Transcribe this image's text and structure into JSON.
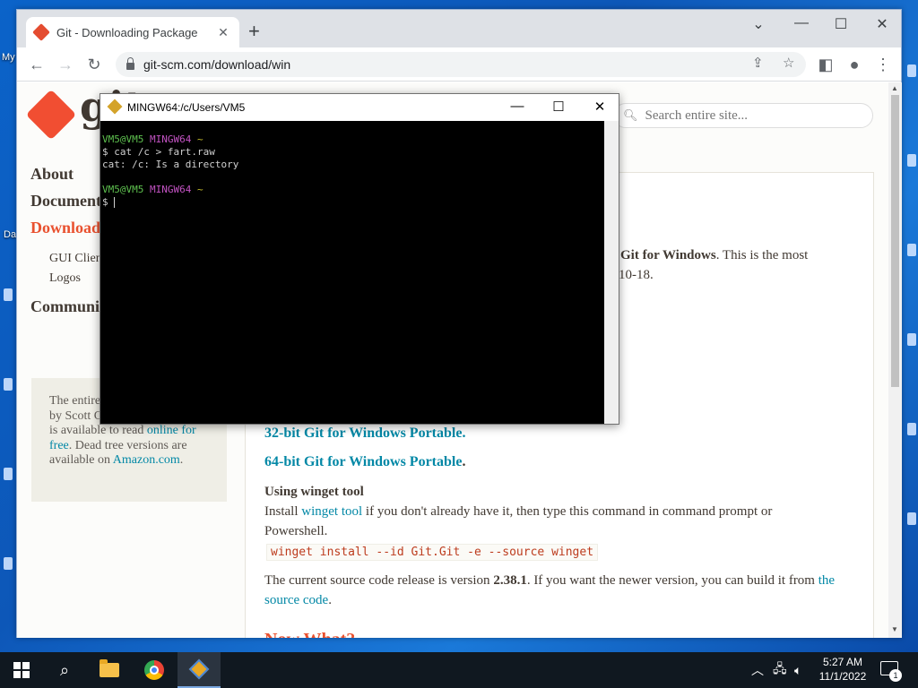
{
  "desktop": {
    "labels": [
      "My",
      "Da"
    ]
  },
  "browser": {
    "tab_title": "Git - Downloading Package",
    "url": "git-scm.com/download/win",
    "icons": {
      "back": "back-arrow-icon",
      "forward": "forward-arrow-icon",
      "reload": "reload-icon",
      "share": "share-icon",
      "bookmark": "star-icon",
      "sidebar": "side-panel-icon",
      "profile": "profile-icon",
      "menu": "kebab-menu-icon"
    }
  },
  "site": {
    "logo_text": "git",
    "search_placeholder": "Search entire site...",
    "nav": [
      {
        "label": "About"
      },
      {
        "label": "Documentation"
      },
      {
        "label": "Downloads"
      },
      {
        "label": "Community"
      }
    ],
    "subnav": [
      "GUI Clients",
      "Logos"
    ],
    "book": {
      "text_before": "The entire Pro Git book written by Scott Chacon and Ben Straub is available to read ",
      "link1": "online for free",
      "text_mid": ". Dead tree versions are available on ",
      "link2": "Amazon.com",
      "text_after": "."
    },
    "main": {
      "intro_bold": "Git for Windows",
      "intro_rest": ". This is the most",
      "intro_line2": "10-18.",
      "portable_32": "32-bit Git for Windows Portable.",
      "portable_64": "64-bit Git for Windows Portable",
      "winget_heading": "Using winget tool",
      "winget_p1_a": "Install ",
      "winget_p1_link": "winget tool",
      "winget_p1_b": " if you don't already have it, then type this command in command prompt or",
      "winget_p1_c": "Powershell.",
      "winget_cmd": "winget install --id Git.Git -e --source winget",
      "source_a": "The current source code release is version ",
      "source_version": "2.38.1",
      "source_b": ". If you want the newer version, you can build it from ",
      "source_link1": "the",
      "source_link2": "source code",
      "source_c": ".",
      "now_what": "Now What?"
    }
  },
  "terminal": {
    "title": "MINGW64:/c/Users/VM5",
    "prompt_user": "VM5@VM5",
    "prompt_env": "MINGW64",
    "prompt_dir": "~",
    "command": "$ cat /c > fart.raw",
    "output": "cat: /c: Is a directory",
    "prompt_symbol": "$ "
  },
  "taskbar": {
    "time": "5:27 AM",
    "date": "11/1/2022",
    "notification_count": "1",
    "icons": [
      "windows-start-icon",
      "search-icon",
      "file-explorer-icon",
      "chrome-icon",
      "git-bash-icon"
    ]
  }
}
